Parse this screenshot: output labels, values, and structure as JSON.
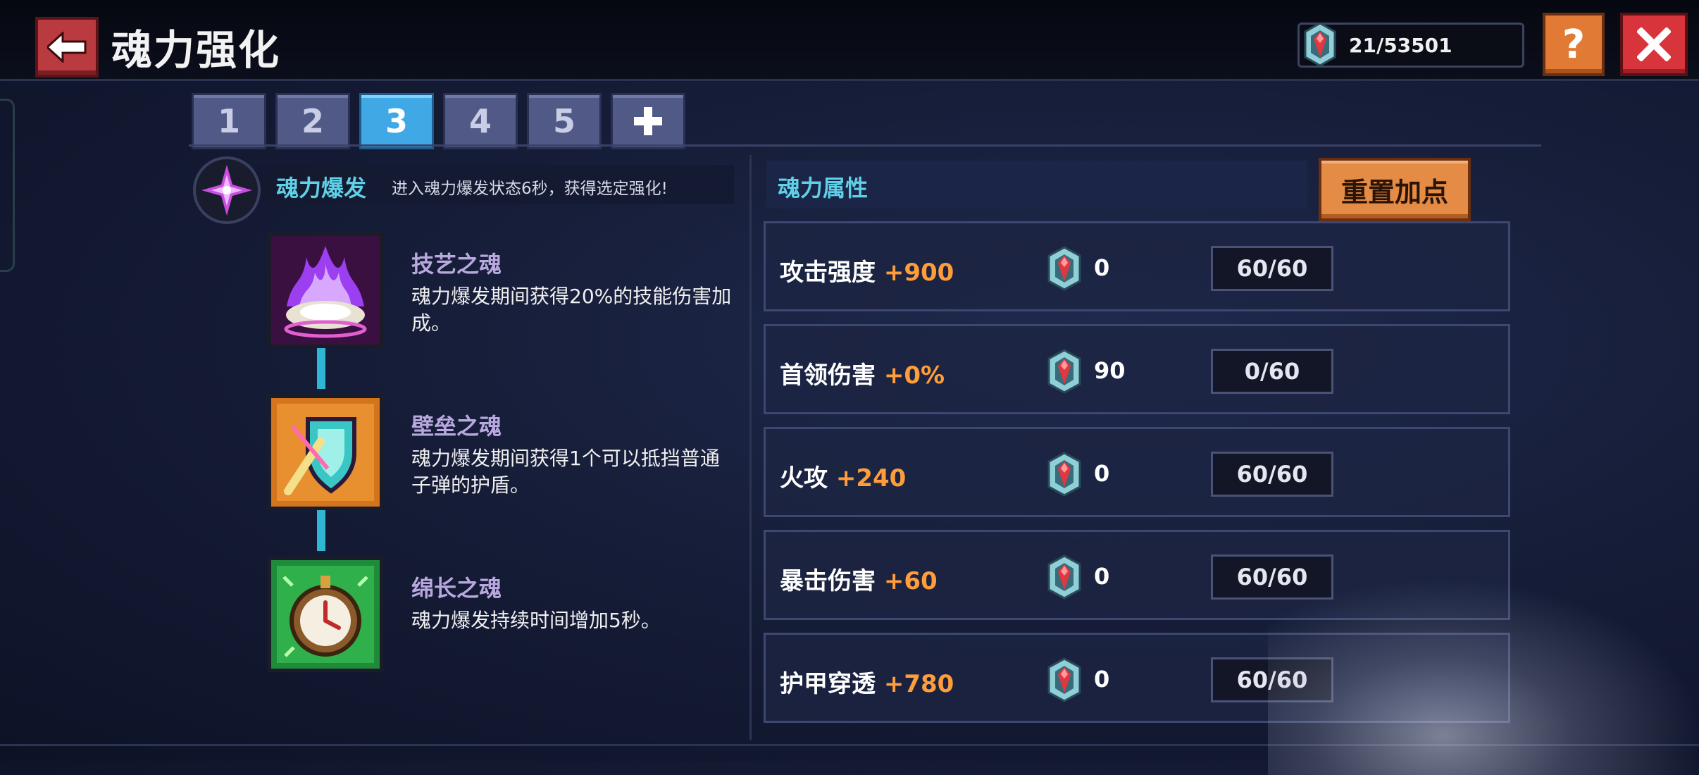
{
  "header": {
    "title": "魂力强化",
    "gem_count": "21/53501",
    "help_label": "?"
  },
  "tabs": [
    "1",
    "2",
    "3",
    "4",
    "5"
  ],
  "active_tab": "3",
  "burst": {
    "title": "魂力爆发",
    "description": "进入魂力爆发状态6秒，获得选定强化!"
  },
  "skills": [
    {
      "name": "技艺之魂",
      "description": "魂力爆发期间获得20%的技能伤害加成。"
    },
    {
      "name": "壁垒之魂",
      "description": "魂力爆发期间获得1个可以抵挡普通子弹的护盾。"
    },
    {
      "name": "绵长之魂",
      "description": "魂力爆发持续时间增加5秒。"
    }
  ],
  "attributes": {
    "title": "魂力属性",
    "reset_label": "重置加点",
    "rows": [
      {
        "name": "攻击强度",
        "bonus": "+900",
        "cost": "0",
        "level": "60/60"
      },
      {
        "name": "首领伤害",
        "bonus": "+0%",
        "cost": "90",
        "level": "0/60"
      },
      {
        "name": "火攻",
        "bonus": "+240",
        "cost": "0",
        "level": "60/60"
      },
      {
        "name": "暴击伤害",
        "bonus": "+60",
        "cost": "0",
        "level": "60/60"
      },
      {
        "name": "护甲穿透",
        "bonus": "+780",
        "cost": "0",
        "level": "60/60"
      }
    ]
  },
  "colors": {
    "accent_cyan": "#5fd0e6",
    "bonus_orange": "#ff9d3a",
    "active_tab": "#41a8e6",
    "close_red": "#d7343c",
    "help_orange": "#e07a34"
  },
  "icons": {
    "back": "arrow-left-icon",
    "gem": "soul-gem-icon",
    "help": "question-icon",
    "close": "close-icon",
    "add_tab": "plus-icon",
    "burst": "soul-burst-icon",
    "skills": [
      "purple-flame-shell-icon",
      "shield-sword-icon",
      "pocket-watch-icon"
    ]
  }
}
